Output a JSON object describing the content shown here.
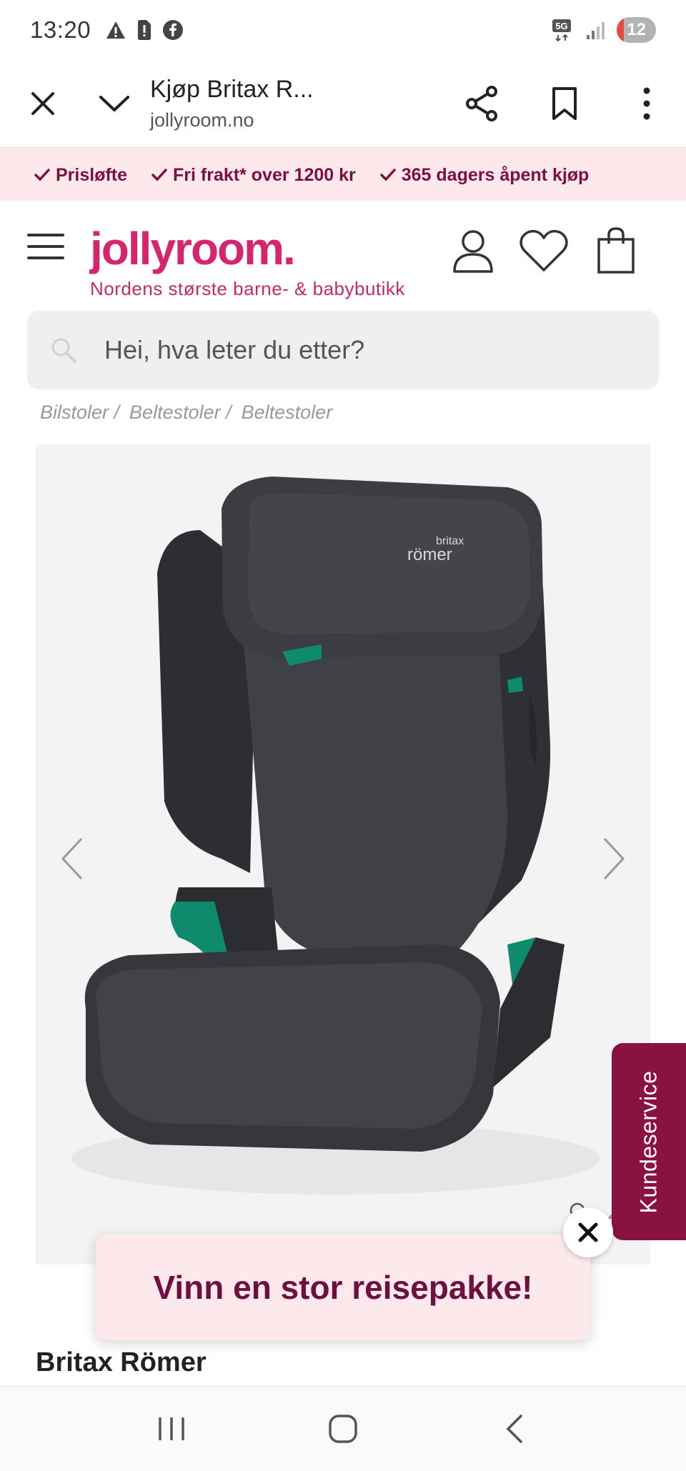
{
  "status_bar": {
    "time": "13:20",
    "battery": "12",
    "network": "5G"
  },
  "browser": {
    "tab_title": "Kjøp Britax R...",
    "url": "jollyroom.no"
  },
  "promo": {
    "items": [
      "Prisløfte",
      "Fri frakt* over 1200 kr",
      "365 dagers åpent kjøp"
    ]
  },
  "header": {
    "logo": "jollyroom.",
    "tagline": "Nordens største barne- & babybutikk"
  },
  "search": {
    "placeholder": "Hei, hva leter du etter?"
  },
  "breadcrumb": {
    "items": [
      "Bilstoler /",
      "Beltestoler /",
      "Beltestoler"
    ]
  },
  "product": {
    "seat_logo_line1": "britax",
    "seat_logo_line2": "römer",
    "zoom_label": "Z",
    "brand": "Britax Römer"
  },
  "customer_service": {
    "label": "Kundeservice"
  },
  "popup": {
    "text": "Vinn en stor reisepakke!"
  },
  "colors": {
    "brand_pink": "#d6256e",
    "promo_bg": "#fde8ec",
    "cs_bg": "#8a1240",
    "seat_dark": "#3a3b40",
    "seat_accent": "#0e8a6c"
  }
}
